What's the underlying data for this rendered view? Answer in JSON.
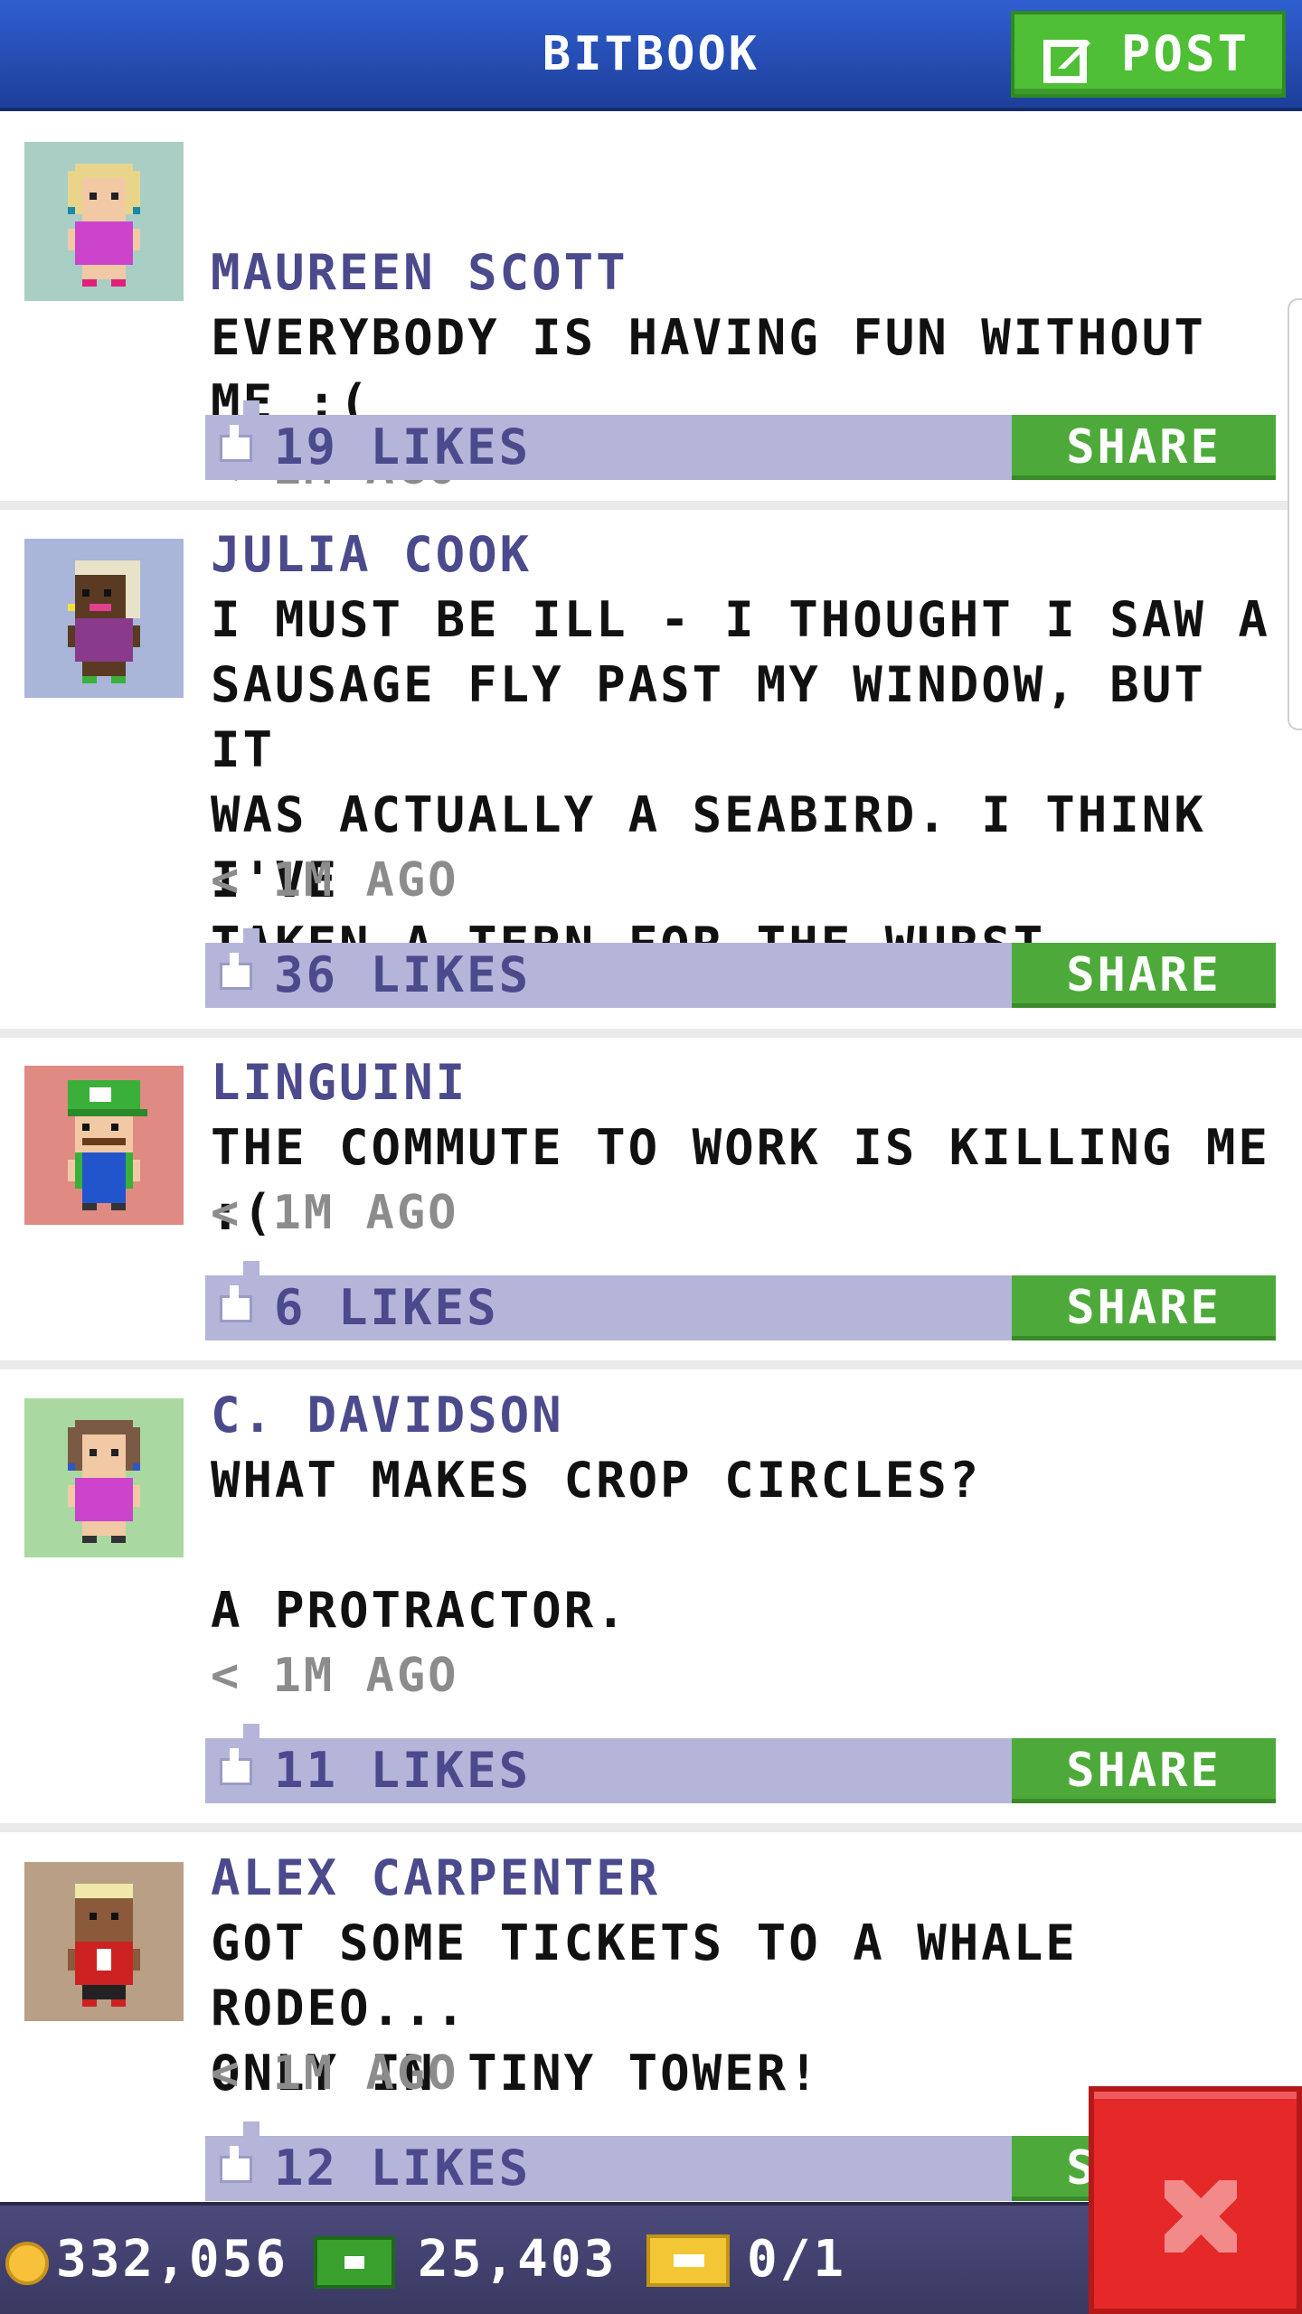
{
  "header": {
    "title": "BITBOOK",
    "post_label": "POST"
  },
  "posts": [
    {
      "author": "MAUREEN SCOTT",
      "text": "EVERYBODY IS HAVING FUN WITHOUT\nME :(",
      "time": "< 1M AGO",
      "likes": "19 LIKES",
      "share": "SHARE",
      "avatar_bg": "#a9cfc5"
    },
    {
      "author": "JULIA COOK",
      "text": "I MUST BE ILL - I THOUGHT I SAW A\nSAUSAGE FLY PAST MY WINDOW, BUT IT\nWAS ACTUALLY A SEABIRD. I THINK I'VE\nTAKEN A TERN FOR THE WURST.",
      "time": "< 1M AGO",
      "likes": "36 LIKES",
      "share": "SHARE",
      "avatar_bg": "#a9b6d9"
    },
    {
      "author": "LINGUINI",
      "text": "THE COMMUTE TO WORK IS KILLING ME :(",
      "time": "< 1M AGO",
      "likes": "6 LIKES",
      "share": "SHARE",
      "avatar_bg": "#e08a84"
    },
    {
      "author": "C. DAVIDSON",
      "text": "WHAT MAKES CROP CIRCLES?\n\nA PROTRACTOR.",
      "time": "< 1M AGO",
      "likes": "11 LIKES",
      "share": "SHARE",
      "avatar_bg": "#a9d9a0"
    },
    {
      "author": "ALEX CARPENTER",
      "text": "GOT SOME TICKETS TO A WHALE RODEO...\nONLY IN TINY TOWER!",
      "time": "< 1M AGO",
      "likes": "12 LIKES",
      "share": "SHARE",
      "avatar_bg": "#b89f86"
    }
  ],
  "footer": {
    "coins": "332,056",
    "bux": "25,403",
    "tickets": "0/1"
  },
  "colors": {
    "header": "#2f5fd0",
    "post_button": "#4fbf35",
    "like_bar": "#b4b5d9",
    "share_button": "#4daa3a",
    "author": "#4b4a8c",
    "close": "#e52828"
  },
  "icons": [
    "edit-icon",
    "like-icon",
    "coin-icon",
    "bux-icon",
    "ticket-icon",
    "close-icon"
  ]
}
